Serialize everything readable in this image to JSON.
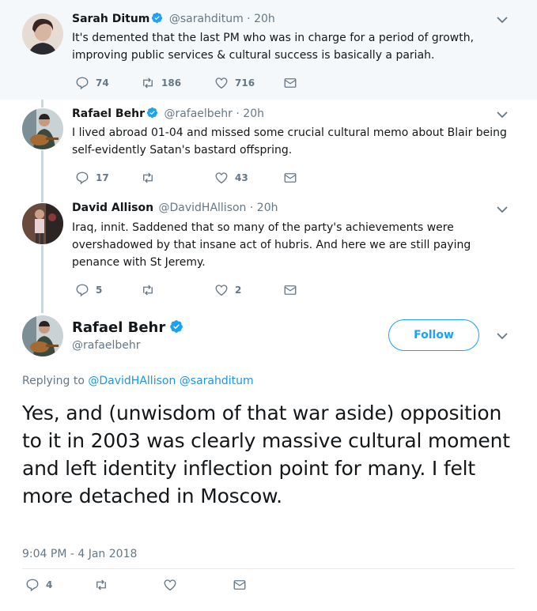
{
  "tweets": [
    {
      "name": "Sarah Ditum",
      "handle": "@sarahditum",
      "dot": "·",
      "time": "20h",
      "text": "It's demented that the last PM who was in charge for a period of growth, improving public services & cultural success is basically a pariah.",
      "replies": "74",
      "retweets": "186",
      "likes": "716"
    },
    {
      "name": "Rafael Behr",
      "handle": "@rafaelbehr",
      "dot": "·",
      "time": "20h",
      "text": "I lived abroad 01-04 and missed some crucial cultural memo about Blair being self-evidently Satan's bastard offspring.",
      "replies": "17",
      "retweets": "",
      "likes": "43"
    },
    {
      "name": "David Allison",
      "handle": "@DavidHAllison",
      "dot": "·",
      "time": "20h",
      "text": "Iraq, innit. Saddened that so many of the party's achievements were overshadowed by that insane act of hubris. And here we are still paying penance with St Jeremy.",
      "replies": "5",
      "retweets": "",
      "likes": "2"
    }
  ],
  "main": {
    "name": "Rafael Behr",
    "handle": "@rafaelbehr",
    "follow_label": "Follow",
    "replying_prefix": "Replying to",
    "mention_1": "@DavidHAllison",
    "mention_2": "@sarahditum",
    "text": "Yes, and (unwisdom of that war aside) opposition to it in 2003 was clearly massive cultural moment and left identity inflection point for many. I felt more detached in Moscow.",
    "timestamp": "9:04 PM - 4 Jan 2018",
    "replies": "4",
    "retweets": "",
    "likes": ""
  },
  "colors": {
    "accent": "#1da1f2",
    "secondary_text": "#657786",
    "highlight_bg": "#f5f8fa",
    "thread_line": "#ccd6dd"
  },
  "icons": [
    "verified-badge-icon",
    "chevron-down-icon",
    "reply-icon",
    "retweet-icon",
    "like-heart-icon",
    "direct-message-icon"
  ]
}
